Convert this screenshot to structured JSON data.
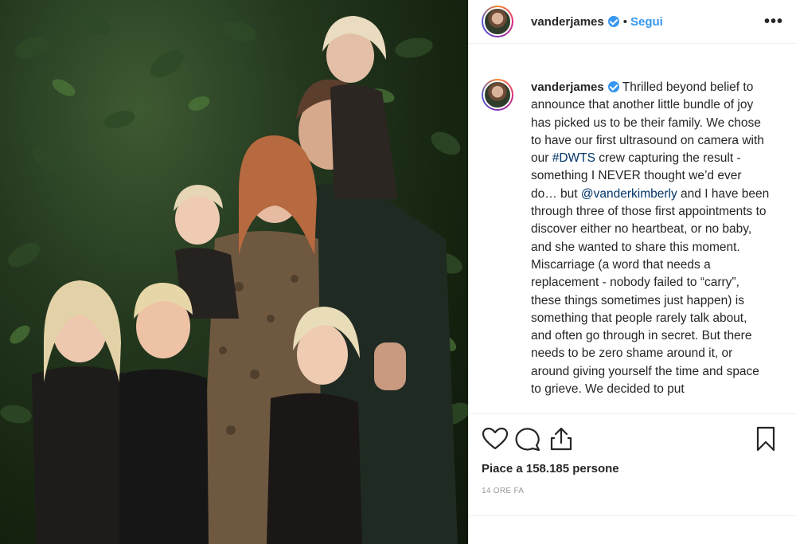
{
  "header": {
    "username": "vanderjames",
    "separator": "•",
    "follow_label": "Segui",
    "more_label": "•••"
  },
  "caption": {
    "username": "vanderjames",
    "text_1": "Thrilled beyond belief to announce that another little bundle of joy has picked us to be their family. We chose to have our first ultrasound on camera with our ",
    "hashtag": "#DWTS",
    "text_2": " crew capturing the result - something I NEVER thought we’d ever do… but ",
    "mention": "@vanderkimberly",
    "text_3": " and I have been through three of those first appointments to discover either no heartbeat, or no baby, and she wanted to share this moment. Miscarriage (a word that needs a replacement - nobody failed to “carry”, these things sometimes just happen) is something that people rarely talk about, and often go through in secret. But there needs to be zero shame around it, or around giving yourself the time and space to grieve. We decided to put"
  },
  "actions": {
    "likes": "Piace a 158.185 persone",
    "timestamp": "14 ORE FA"
  },
  "icons": [
    "heart-icon",
    "comment-icon",
    "share-icon",
    "bookmark-icon",
    "verified-icon"
  ],
  "colors": {
    "link": "#003569",
    "follow": "#3897f0",
    "verified": "#3897f0"
  }
}
